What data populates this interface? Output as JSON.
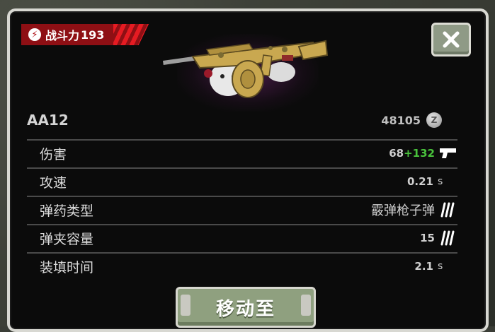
{
  "power": {
    "label": "战斗力",
    "value": "193",
    "icon": "power-icon"
  },
  "close": {
    "icon": "close-icon"
  },
  "weapon": {
    "name": "AA12",
    "score": "48105",
    "coin_symbol": "Z"
  },
  "stats": [
    {
      "label": "伤害",
      "value": "68",
      "bonus": "+132",
      "icon": "pistol-icon"
    },
    {
      "label": "攻速",
      "value": "0.21",
      "unit": "s"
    },
    {
      "label": "弹药类型",
      "value": "霰弹枪子弹",
      "icon": "ammo-icon"
    },
    {
      "label": "弹夹容量",
      "value": "15",
      "icon": "ammo-icon"
    },
    {
      "label": "装填时间",
      "value": "2.1",
      "unit": "s"
    }
  ],
  "action": {
    "label": "移动至"
  },
  "colors": {
    "power_red": "#8e0f14",
    "bonus_green": "#49c23c",
    "button_green": "#8fa07f"
  }
}
